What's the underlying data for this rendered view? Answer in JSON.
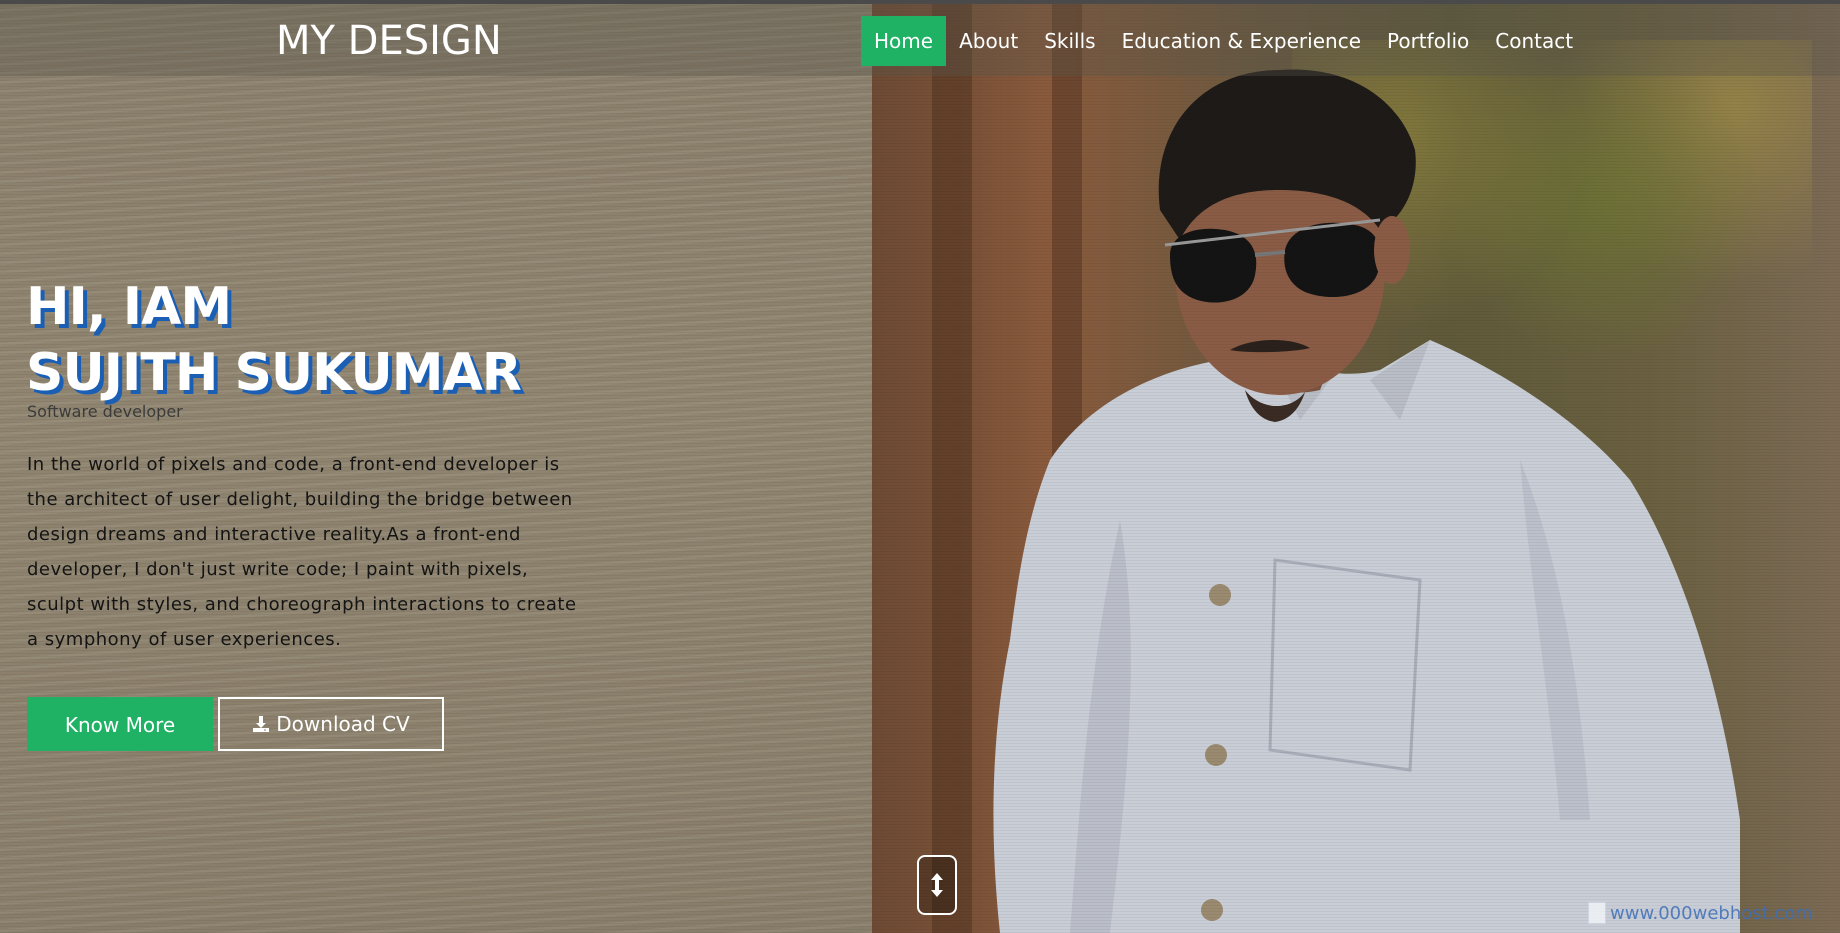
{
  "brand": {
    "title": "MY DESIGN"
  },
  "nav": {
    "items": [
      {
        "label": "Home",
        "active": true
      },
      {
        "label": "About",
        "active": false
      },
      {
        "label": "Skills",
        "active": false
      },
      {
        "label": "Education & Experience",
        "active": false
      },
      {
        "label": "Portfolio",
        "active": false
      },
      {
        "label": "Contact",
        "active": false
      }
    ]
  },
  "hero": {
    "greeting": "HI, IAM",
    "name": "SUJITH SUKUMAR",
    "role": "Software developer",
    "description": "In the world of pixels and code, a front-end developer is the architect of user delight, building the bridge between design dreams and interactive reality.As a front-end developer, I don't just write code; I paint with pixels, sculpt with styles, and choreograph interactions to create a symphony of user experiences.",
    "primary_button": "Know More",
    "secondary_button": "Download CV",
    "secondary_icon": "download-icon"
  },
  "scroll_button": {
    "icon": "up-down-arrow-icon"
  },
  "watermark": {
    "text": "www.000webhost.com"
  },
  "colors": {
    "accent": "#1fb264",
    "title_shadow": "#1a5fb4",
    "text_light": "#ffffff",
    "text_dark": "#141414"
  }
}
